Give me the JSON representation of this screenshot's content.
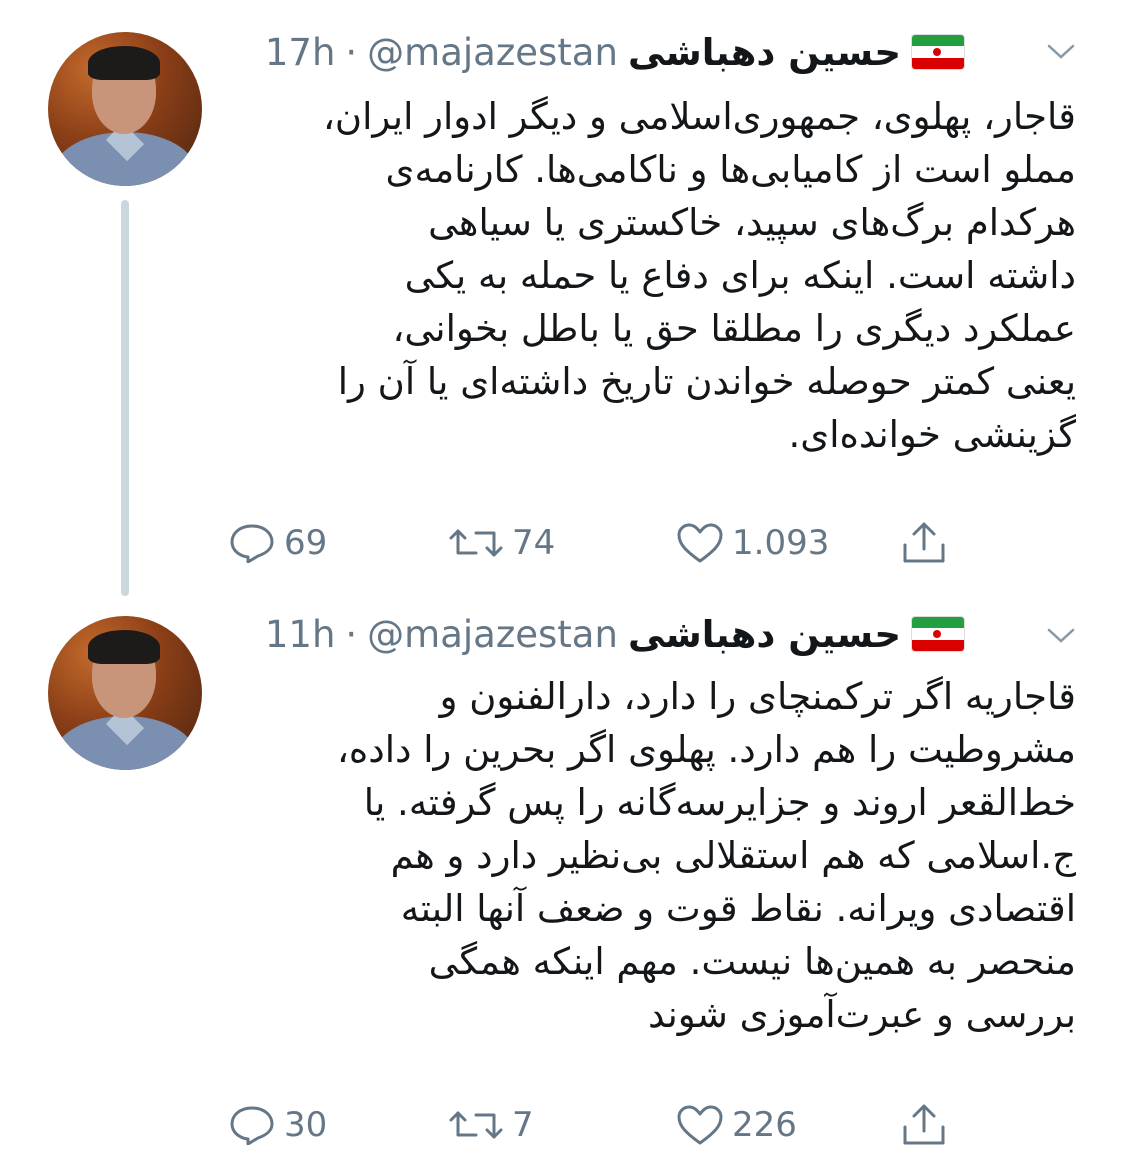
{
  "tweets": [
    {
      "author": {
        "name": "حسین دهباشی",
        "flag_icon": "iran-flag-icon",
        "handle": "@majazestan",
        "separator": "·",
        "time": "17h"
      },
      "text": "قاجار، پهلوی، جمهوری‌اسلامی و دیگر ادوار ایران،\nمملو است از کامیابی‌ها و ناکامی‌ها. کارنامه‌ی\nهرکدام برگ‌های سپید، خاکستری یا سیاهی\nداشته است. اینکه برای دفاع یا حمله به یکی\nعملکرد دیگری را مطلقا حق یا باطل بخوانی،\nیعنی کمتر حوصله خواندن تاریخ داشته‌ای یا آن را\nگزینشی خوانده‌ای.",
      "actions": {
        "replies": "69",
        "retweets": "74",
        "likes": "1.093"
      }
    },
    {
      "author": {
        "name": "حسین دهباشی",
        "flag_icon": "iran-flag-icon",
        "handle": "@majazestan",
        "separator": "·",
        "time": "11h"
      },
      "text": "قاجاریه اگر ترکمنچای را دارد، دارالفنون و\nمشروطیت را هم دارد. پهلوی اگر بحرین را داده،\nخط‌القعر اروند و جزایرسه‌گانه را پس گرفته. یا\nج.اسلامی که هم استقلالی بی‌نظیر دارد و هم\nاقتصادی ویرانه. نقاط قوت و ضعف آنها البته\nمنحصر به همین‌ها نیست. مهم اینکه همگی\nبررسی و عبرت‌آموزی شوند",
      "actions": {
        "replies": "30",
        "retweets": "7",
        "likes": "226"
      }
    }
  ],
  "colors": {
    "text": "#14171a",
    "secondary": "#657786",
    "thread_line": "#ccd6dd"
  }
}
